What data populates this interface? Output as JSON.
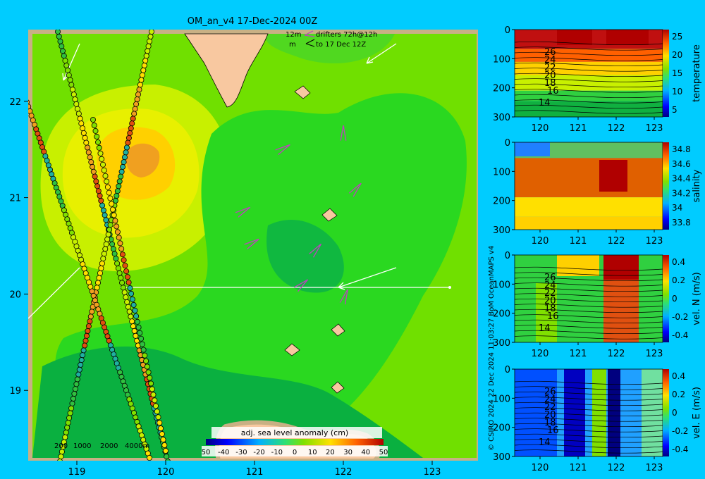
{
  "header": {
    "title": "OM_an_v4  17-Dec-2024 00Z",
    "legend_12m": "12m",
    "legend_m": "m",
    "legend_drifters": "drifters 72h@12h",
    "legend_to": "to 17 Dec 12Z"
  },
  "credits": {
    "vertical": "© CSIRO 2024   22 Dec 2024 11:03:27 BoM OceanMAPS v4"
  },
  "chart_data": [
    {
      "type": "heatmap",
      "name": "map",
      "xlim": [
        118.5,
        123.5
      ],
      "ylim": [
        18.3,
        22.7
      ],
      "xticks": [
        119,
        120,
        121,
        122,
        123
      ],
      "yticks": [
        19,
        20,
        21,
        22
      ],
      "colorbar": {
        "title": "adj. sea level anomaly (cm)",
        "range": [
          -50,
          50
        ],
        "ticks": [
          "-50",
          "-40",
          "-30",
          "-20",
          "-10",
          "0",
          "10",
          "20",
          "30",
          "40",
          "50"
        ],
        "first_tick": "50"
      },
      "depth_legend": [
        "200",
        "1000",
        "2000",
        "4000m"
      ],
      "drifters": [
        {
          "lon": 121.05,
          "lat": 20.57,
          "dir": 200
        },
        {
          "lon": 121.75,
          "lat": 20.52,
          "dir": 220
        },
        {
          "lon": 122.05,
          "lat": 20.05,
          "dir": 240
        },
        {
          "lon": 121.4,
          "lat": 21.55,
          "dir": 200
        },
        {
          "lon": 122.0,
          "lat": 21.75,
          "dir": 260
        },
        {
          "lon": 120.95,
          "lat": 20.9,
          "dir": 200
        },
        {
          "lon": 122.2,
          "lat": 21.15,
          "dir": 220
        },
        {
          "lon": 121.6,
          "lat": 20.15,
          "dir": 210
        }
      ],
      "colors": {
        "land": "#f8c8a0",
        "coast": "#c8b084",
        "pos": "#f0a020",
        "neg": "#0ab040"
      }
    },
    {
      "type": "heatmap",
      "name": "temperature",
      "xticks": [
        120,
        121,
        122,
        123
      ],
      "yticks": [
        0,
        100,
        200,
        300
      ],
      "colorbar_ticks": [
        "25",
        "20",
        "15",
        "10",
        "5"
      ],
      "label": "temperature",
      "contours": [
        "26",
        "24",
        "22",
        "20",
        "18",
        "16",
        "14"
      ]
    },
    {
      "type": "heatmap",
      "name": "salinity",
      "xticks": [
        120,
        121,
        122,
        123
      ],
      "yticks": [
        0,
        100,
        200,
        300
      ],
      "colorbar_ticks": [
        "34.8",
        "34.6",
        "34.4",
        "34.2",
        "34",
        "33.8"
      ],
      "label": "salinity"
    },
    {
      "type": "heatmap",
      "name": "vel_N",
      "xticks": [
        120,
        121,
        122,
        123
      ],
      "yticks": [
        0,
        100,
        200,
        300
      ],
      "colorbar_ticks": [
        "0.4",
        "0.2",
        "0",
        "-0.2",
        "-0.4"
      ],
      "label": "vel. N (m/s)",
      "contours": [
        "26",
        "24",
        "22",
        "20",
        "18",
        "16",
        "14"
      ]
    },
    {
      "type": "heatmap",
      "name": "vel_E",
      "xticks": [
        120,
        121,
        122,
        123
      ],
      "yticks": [
        0,
        100,
        200,
        300
      ],
      "colorbar_ticks": [
        "0.4",
        "0.2",
        "0",
        "-0.2",
        "-0.4"
      ],
      "label": "vel. E (m/s)",
      "contours": [
        "26",
        "24",
        "22",
        "20",
        "18",
        "16",
        "14"
      ]
    }
  ]
}
